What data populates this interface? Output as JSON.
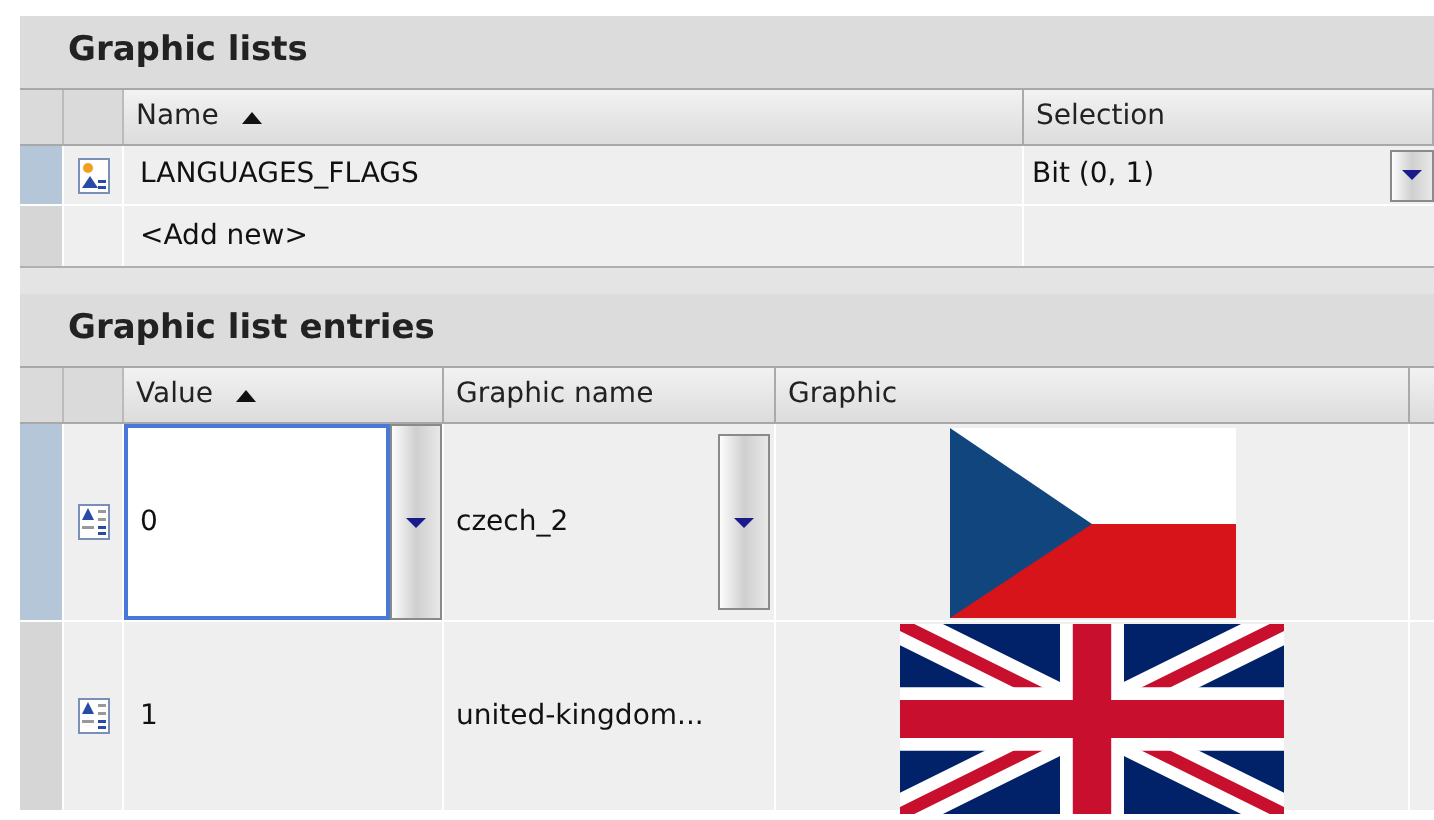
{
  "graphic_lists": {
    "title": "Graphic lists",
    "columns": [
      {
        "label": "Name",
        "sorted": true
      },
      {
        "label": "Selection",
        "sorted": false
      }
    ],
    "rows": [
      {
        "name": "LANGUAGES_FLAGS",
        "selection": "Bit (0, 1)",
        "selected": true
      }
    ],
    "add_new": "<Add new>"
  },
  "graphic_list_entries": {
    "title": "Graphic list entries",
    "columns": [
      {
        "label": "Value",
        "sorted": true
      },
      {
        "label": "Graphic name",
        "sorted": false
      },
      {
        "label": "Graphic",
        "sorted": false
      }
    ],
    "rows": [
      {
        "value": "0",
        "graphic_name": "czech_2",
        "kind": "czech_flag",
        "selected": true
      },
      {
        "value": "1",
        "graphic_name": "united-kingdom...",
        "kind": "uk_flag",
        "selected": false
      }
    ]
  }
}
